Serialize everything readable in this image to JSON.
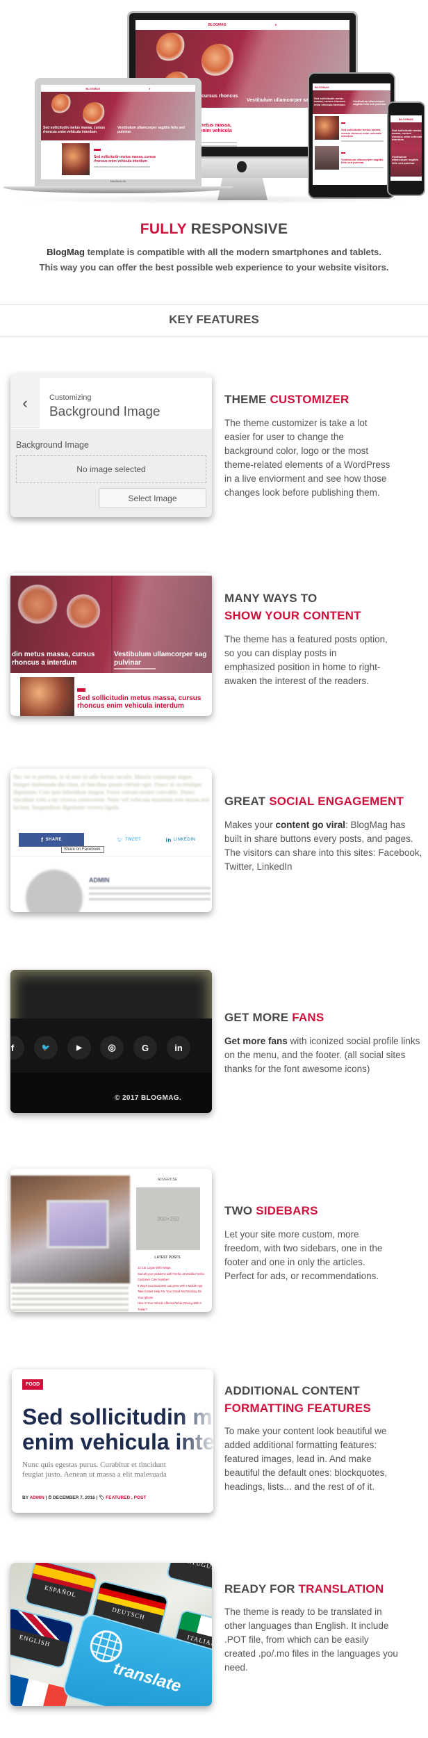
{
  "hero": {
    "site_logo": "BLOGMAG",
    "featured_caption_1": "Sed sollicitudin metus massa, cursus rhoncus enim vehicula interdum",
    "featured_caption_1_short": "cursus rhoncus",
    "featured_caption_2": "Vestibulum ullamcorper sagittis felis sed pulvinar",
    "featured_caption_2_short": "Vestibulum ullamcorper sag",
    "post_title": "Sed sollicitudin metus massa, cursus rhoncus enim vehicula interdum",
    "post_title_2": "Vestibulum ullamcorper sagittis felis sed pulvinar",
    "laptop_label": "MacBook Air"
  },
  "intro": {
    "title_accent": "FULLY",
    "title_rest": "RESPONSIVE",
    "brand": "BlogMag",
    "line1_rest": " template is compatible with all the modern smartphones and tablets.",
    "line2": "This way you can offer the best possible web experience to your website visitors."
  },
  "key_features_title": "KEY FEATURES",
  "colors": {
    "accent": "#d0103a",
    "heading": "#4a4a4a",
    "text": "#555555"
  },
  "features": [
    {
      "title_plain": "THEME",
      "title_accent": "CUSTOMIZER",
      "description": "The theme customizer is take a lot easier for user to change the background color, logo or the most theme-related elements of a WordPress in a live enviorment and see how those changes look before publishing them.",
      "screenshot": {
        "back_icon": "chevron-left-icon",
        "small_title": "Customizing",
        "big_title": "Background Image",
        "field_label": "Background Image",
        "placeholder": "No image selected",
        "button": "Select Image"
      }
    },
    {
      "title_plain": "MANY WAYS TO",
      "title_accent": "SHOW YOUR CONTENT",
      "description": "The  theme has a featured posts option, so you can display posts in emphasized position in home to right-awaken the interest of the readers.",
      "screenshot": {
        "caption_1": "din metus massa, cursus rhoncus a interdum",
        "caption_2": "Vestibulum ullamcorper sag pulvinar",
        "post_title": "Sed sollicitudin metus massa, cursus rhoncus enim vehicula interdum"
      }
    },
    {
      "title_plain": "GREAT",
      "title_accent": "SOCIAL ENGAGEMENT",
      "description_pre": "Makes your ",
      "description_bold": "content go viral",
      "description_post": ": BlogMag has built in share buttons every posts, and pages.",
      "description_line2": "The visitors can share into this sites: Facebook, Twitter, LinkedIn",
      "screenshot": {
        "body_text": "Nec mi in pretium, in id sem id odio luctus iaculis. Mauris consequat augue. Integer malesuada dui risus, et faucibus ipsum rutrum eget. Fusce ut eu tristique dignissim. Cras quis bibendum magna. Fusce rutrum ornare convallis. Donec tincidunt velit a mi viverra consectetur. Nunc vel vehicula maximus non massa sed lacinia. Suspendisse dignissim viverra ligula.",
        "share_label": "SHARE",
        "tweet_label": "TWEET",
        "linkedin_label": "LINKEDIN",
        "tooltip": "Share on Facebook.",
        "author": "ADMIN"
      }
    },
    {
      "title_plain": "GET MORE",
      "title_accent": "FANS",
      "description_bold": "Get more fans",
      "description_rest": " with iconized social profile links on the menu, and the footer. (all social sites thanks for the font awesome icons)",
      "screenshot": {
        "icons": [
          "facebook-icon",
          "twitter-icon",
          "youtube-icon",
          "instagram-icon",
          "google-icon",
          "linkedin-icon"
        ],
        "icon_glyphs": [
          "f",
          "🐦",
          "▶",
          "◎",
          "G",
          "in"
        ],
        "copyright": "© 2017 BLOGMAG."
      }
    },
    {
      "title_plain": "TWO",
      "title_accent": "SIDEBARS",
      "description": "Let your site more custom, more freedom, with two sidebars, one in the footer and one in only the articles. Perfect for ads, or recommendations.",
      "screenshot": {
        "advertise": "ADVERTISE",
        "ad_size": "300×250",
        "latest_posts": "LATEST POSTS",
        "posts": [
          "12 Car Logos With Wings",
          "Sort all your problems with Firefox at Mozilla Firefox Customer Care Number!",
          "5 Ways your Business can grow with a Mobile App",
          "Take Instant Help For Your Gmail Not Working On Your Iphone",
          "How Is Your Vehicle Affected While Driving With A Trailer?"
        ]
      }
    },
    {
      "title_plain": "ADDITIONAL CONTENT",
      "title_accent": "FORMATTING FEATURES",
      "description": "To make your content look beautiful we added additional formatting features: featured images, lead in. And make beautiful the default ones: blockquotes, headings, lists... and the rest of of it.",
      "screenshot": {
        "tag": "FOOD",
        "title_line1": "Sed sollicitudin met",
        "title_line2": "enim vehicula interd",
        "lead_line1": "Nunc quis egestas purus. Curabitur et tincidunt",
        "lead_line2": "feugiat justo. Aenean ut massa a elit malesuada",
        "meta_by": "BY ",
        "meta_author": "ADMIN",
        "meta_date": " | ⏱ DECEMBER 7, 2016 | ",
        "meta_cats": "FEATURED , POST"
      }
    },
    {
      "title_plain": "READY FOR",
      "title_accent": "TRANSLATION",
      "description": "The theme is ready to be translated in other languages than English. It include .POT file, from which can be easily created  .po/.mo files in the languages you need.",
      "screenshot": {
        "keys": [
          "ESPAÑOL",
          "DEUTSCH",
          "ENGLISH",
          "ITALIANO",
          "PORTUGUÊS"
        ],
        "button": "translate"
      }
    }
  ]
}
